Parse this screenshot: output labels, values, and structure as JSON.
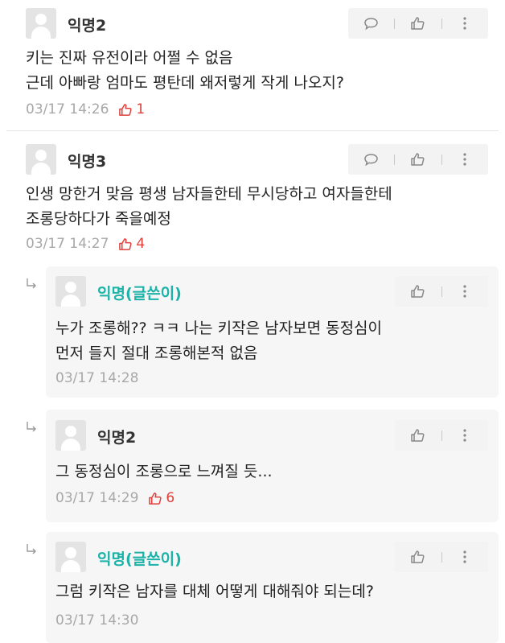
{
  "comments": [
    {
      "author": "익명2",
      "lines": [
        "키는 진짜 유전이라 어쩔 수 없음",
        "근데 아빠랑 엄마도 평탄데 왜저렇게 작게 나오지?"
      ],
      "time": "03/17 14:26",
      "likes": "1"
    },
    {
      "author": "익명3",
      "lines": [
        "인생 망한거 맞음 평생 남자들한테 무시당하고 여자들한테",
        "조롱당하다가 죽을예정"
      ],
      "time": "03/17 14:27",
      "likes": "4"
    }
  ],
  "replies": [
    {
      "author": "익명(글쓴이)",
      "lines": [
        "누가 조롱해?? ㅋㅋ 나는 키작은 남자보면 동정심이",
        "먼저 들지 절대 조롱해본적 없음"
      ],
      "time": "03/17 14:28",
      "likes": ""
    },
    {
      "author": "익명2",
      "lines": [
        "그 동정심이 조롱으로 느껴질 듯..."
      ],
      "time": "03/17 14:29",
      "likes": "6"
    },
    {
      "author": "익명(글쓴이)",
      "lines": [
        "그럼 키작은 남자를 대체 어떻게 대해줘야 되는데?"
      ],
      "time": "03/17 14:30",
      "likes": ""
    }
  ],
  "icons": {
    "comment": "speech-bubble-icon",
    "like": "thumbs-up-icon",
    "more": "vertical-dots-icon",
    "reply_arrow": "reply-arrow-icon"
  },
  "colors": {
    "author_highlight": "#1bb3a8",
    "like_red": "#e0413c",
    "meta_gray": "#a8a8a8",
    "reply_bg": "#f6f6f6",
    "action_bg": "#f3f3f3"
  }
}
